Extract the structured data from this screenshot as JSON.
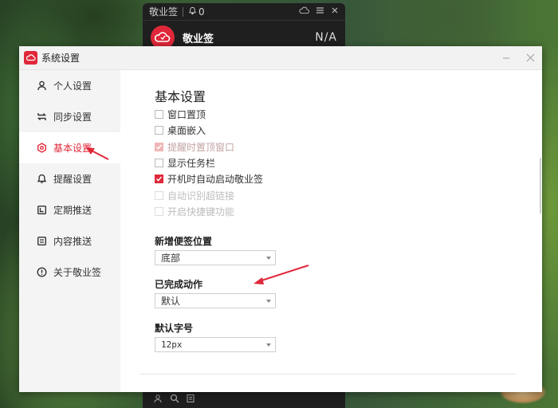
{
  "widget": {
    "title": "敬业签",
    "bell_count": "0",
    "name": "敬业签",
    "status": "N/A"
  },
  "window": {
    "title": "系统设置"
  },
  "sidebar": {
    "items": [
      {
        "label": "个人设置",
        "icon": "user-icon"
      },
      {
        "label": "同步设置",
        "icon": "sync-icon"
      },
      {
        "label": "基本设置",
        "icon": "settings-icon"
      },
      {
        "label": "提醒设置",
        "icon": "bell-icon"
      },
      {
        "label": "定期推送",
        "icon": "calendar-icon"
      },
      {
        "label": "内容推送",
        "icon": "document-icon"
      },
      {
        "label": "关于敬业签",
        "icon": "info-icon"
      }
    ],
    "active_index": 2
  },
  "content": {
    "section_title": "基本设置",
    "options": [
      {
        "label": "窗口置顶",
        "checked": false,
        "disabled": false
      },
      {
        "label": "桌面嵌入",
        "checked": false,
        "disabled": false
      },
      {
        "label": "提醒时置顶窗口",
        "checked": true,
        "disabled": true
      },
      {
        "label": "显示任务栏",
        "checked": false,
        "disabled": false
      },
      {
        "label": "开机时自动启动敬业签",
        "checked": true,
        "disabled": false
      },
      {
        "label": "自动识别超链接",
        "checked": false,
        "disabled": true
      },
      {
        "label": "开启快捷键功能",
        "checked": false,
        "disabled": true
      }
    ],
    "new_note_position": {
      "label": "新增便签位置",
      "value": "底部"
    },
    "completed_action": {
      "label": "已完成动作",
      "value": "默认"
    },
    "default_font_size": {
      "label": "默认字号",
      "value": "12px"
    }
  },
  "colors": {
    "accent": "#e0283a",
    "sidebar_bg": "#f4f4f4",
    "titlebar_bg": "#f2f2f2"
  }
}
